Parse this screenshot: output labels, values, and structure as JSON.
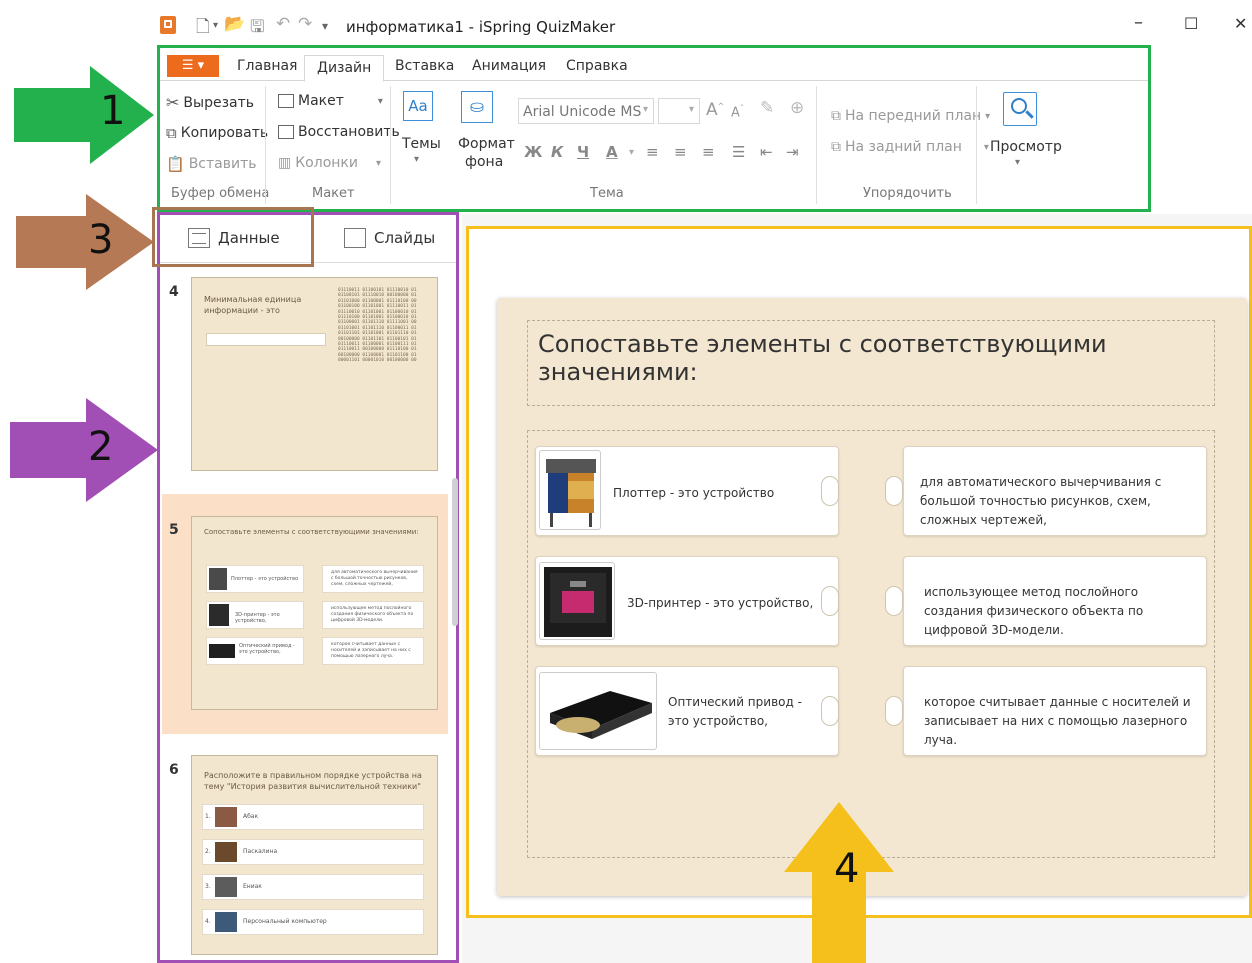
{
  "window": {
    "title": "информатика1 - iSpring QuizMaker",
    "minimize": "–",
    "maximize": "☐",
    "close": "✕"
  },
  "ribbon": {
    "file_button": "☰ ▾",
    "tabs": [
      "Главная",
      "Дизайн",
      "Вставка",
      "Анимация",
      "Справка"
    ],
    "clipboard": {
      "cut": "Вырезать",
      "copy": "Копировать",
      "paste": "Вставить",
      "group_label": "Буфер обмена"
    },
    "layout": {
      "layout": "Макет",
      "restore": "Восстановить",
      "columns": "Колонки",
      "group_label": "Макет"
    },
    "theme": {
      "themes": "Темы",
      "bg_format_line1": "Формат",
      "bg_format_line2": "фона",
      "font_name": "Arial Unicode MS",
      "group_label": "Тема"
    },
    "arrange": {
      "bring_front": "На передний план",
      "send_back": "На задний план",
      "group_label": "Упорядочить"
    },
    "preview": "Просмотр"
  },
  "left_panel": {
    "tab_data": "Данные",
    "tab_slides": "Слайды",
    "slides": [
      {
        "number": "4",
        "title": "Минимальная единица информации - это",
        "binary": "01110011 01100101 01110010 01\n01100101 01110010 00100000 01\n01101000 01100001 01110100 00\n01100100 01101001 01110011 01\n01110010 01101001 01100010 01\n01110100 01101001 01100010 01\n01100001 01101110 01111001 00\n01101001 01101110 01100011 01\n01101101 01101001 01101110 01\n00100000 01101101 01100101 01\n01110011 01100001 01100111 01\n01110011 00100000 01110100 01\n00100000 01100001 01101100 01\n00001101 00001010 00100000 00"
      },
      {
        "number": "5",
        "title": "Сопоставьте элементы с соответствующими значениями:",
        "rows": [
          {
            "left": "Плоттер - это устройство",
            "right": "для автоматического вычерчивания с большой точностью рисунков, схем, сложных чертежей,"
          },
          {
            "left": "3D-принтер - это устройство,",
            "right": "использующее метод послойного создания физического объекта по цифровой 3D-модели."
          },
          {
            "left": "Оптический привод - это устройство,",
            "right": "которое считывает данные с носителей и записывает на них с помощью лазерного луча."
          }
        ]
      },
      {
        "number": "6",
        "title": "Расположите в правильном порядке устройства на тему \"История развития вычислительной техники\"",
        "items": [
          {
            "num": "1.",
            "label": "Абак"
          },
          {
            "num": "2.",
            "label": "Паскалина"
          },
          {
            "num": "3.",
            "label": "Eниак"
          },
          {
            "num": "4.",
            "label": "Персональный компьютер"
          }
        ]
      }
    ]
  },
  "stage": {
    "question": "Сопоставьте элементы с соответствующими значениями:",
    "pairs": [
      {
        "premise": "Плоттер - это устройство",
        "response": "для автоматического вычерчивания с большой точностью рисунков, схем, сложных чертежей,"
      },
      {
        "premise": "3D-принтер - это устройство,",
        "response": "использующее метод послойного создания физического объекта по цифровой 3D-модели."
      },
      {
        "premise": "Оптический привод - это устройство,",
        "response": "которое считывает данные с носителей и записывает на них с помощью лазерного луча."
      }
    ]
  },
  "annotations": {
    "arrow1": "1",
    "arrow2": "2",
    "arrow3": "3",
    "arrow4": "4"
  },
  "colors": {
    "ribbon_frame": "#22b14c",
    "panel_frame": "#a14fb4",
    "tab_frame": "#a87552",
    "stage_frame": "#f5c01b",
    "file_button": "#ec6b1d",
    "arrow_green": "#22b14c",
    "arrow_purple": "#a14fb4",
    "arrow_brown": "#b57a55",
    "arrow_yellow": "#f5c01b"
  }
}
